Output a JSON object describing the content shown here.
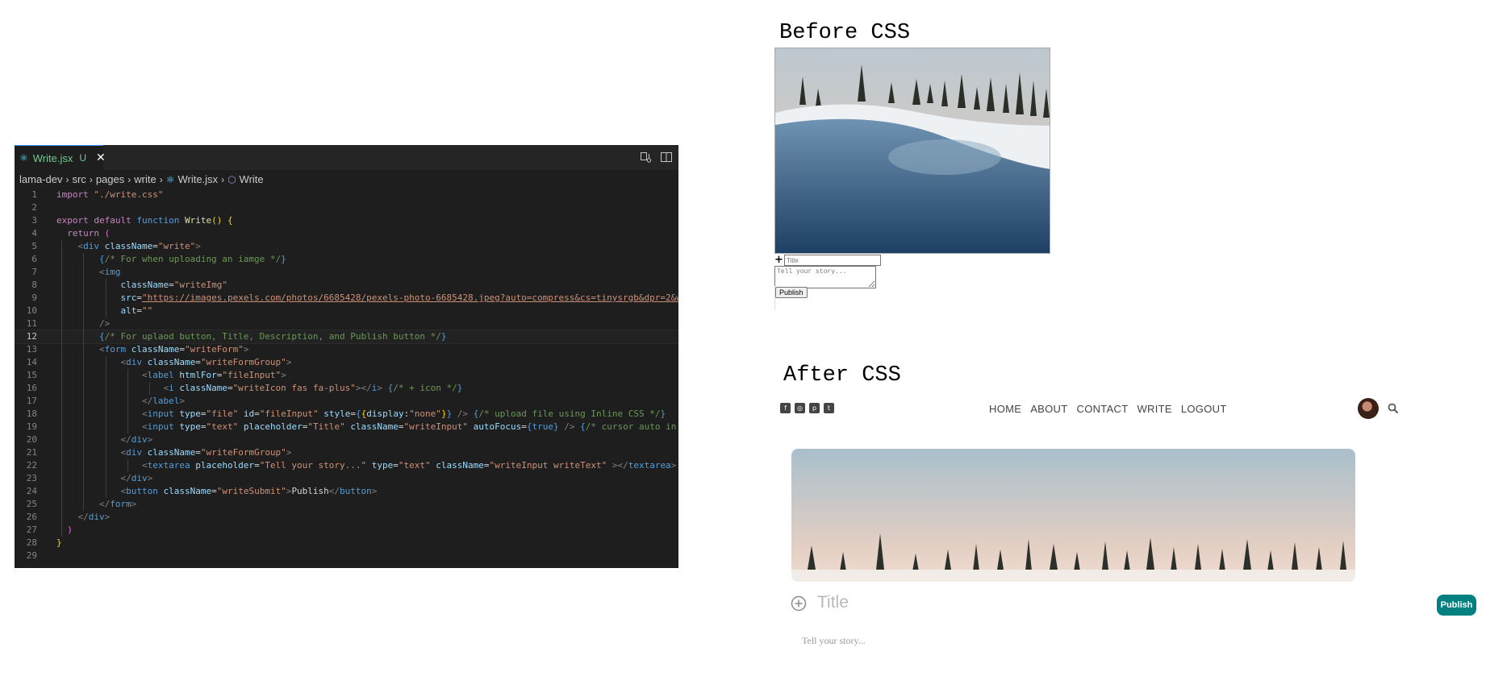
{
  "editor": {
    "tab": {
      "filename": "Write.jsx",
      "status": "U"
    },
    "breadcrumb": [
      "lama-dev",
      "src",
      "pages",
      "write",
      "Write.jsx",
      "Write"
    ],
    "current_line": 12,
    "line_numbers": [
      "1",
      "2",
      "3",
      "4",
      "5",
      "6",
      "7",
      "8",
      "9",
      "10",
      "11",
      "12",
      "13",
      "14",
      "15",
      "16",
      "17",
      "18",
      "19",
      "20",
      "21",
      "22",
      "23",
      "24",
      "25",
      "26",
      "27",
      "28",
      "29"
    ],
    "lines": [
      [
        [
          "kw",
          "import"
        ],
        [
          "txt",
          " "
        ],
        [
          "str",
          "\"./write.css\""
        ]
      ],
      [],
      [
        [
          "kw",
          "export"
        ],
        [
          "txt",
          " "
        ],
        [
          "kw",
          "default"
        ],
        [
          "txt",
          " "
        ],
        [
          "kw2",
          "function"
        ],
        [
          "txt",
          " "
        ],
        [
          "fn",
          "Write"
        ],
        [
          "brace",
          "()"
        ],
        [
          "txt",
          " "
        ],
        [
          "brace",
          "{"
        ]
      ],
      [
        [
          "txt",
          "  "
        ],
        [
          "kw",
          "return"
        ],
        [
          "txt",
          " "
        ],
        [
          "pink",
          "("
        ]
      ],
      [
        [
          "txt",
          "    "
        ],
        [
          "punc",
          "<"
        ],
        [
          "tag",
          "div"
        ],
        [
          "txt",
          " "
        ],
        [
          "attr",
          "className"
        ],
        [
          "txt",
          "="
        ],
        [
          "str",
          "\"write\""
        ],
        [
          "punc",
          ">"
        ]
      ],
      [
        [
          "txt",
          "        "
        ],
        [
          "tag",
          "{"
        ],
        [
          "cmt",
          "/* For when uploading an iamge */"
        ],
        [
          "tag",
          "}"
        ]
      ],
      [
        [
          "txt",
          "        "
        ],
        [
          "punc",
          "<"
        ],
        [
          "tag",
          "img"
        ]
      ],
      [
        [
          "txt",
          "            "
        ],
        [
          "attr",
          "className"
        ],
        [
          "txt",
          "="
        ],
        [
          "str",
          "\"writeImg\""
        ]
      ],
      [
        [
          "txt",
          "            "
        ],
        [
          "attr",
          "src"
        ],
        [
          "txt",
          "="
        ],
        [
          "link",
          "\"https://images.pexels.com/photos/6685428/pexels-photo-6685428.jpeg?auto=compress&cs=tinysrgb&dpr=2&w"
        ]
      ],
      [
        [
          "txt",
          "            "
        ],
        [
          "attr",
          "alt"
        ],
        [
          "txt",
          "="
        ],
        [
          "str",
          "\"\""
        ]
      ],
      [
        [
          "txt",
          "        "
        ],
        [
          "punc",
          "/>"
        ]
      ],
      [
        [
          "txt",
          "        "
        ],
        [
          "tag",
          "{"
        ],
        [
          "cmt",
          "/* For uplaod button, Title, Description, and Publish button */"
        ],
        [
          "tag",
          "}"
        ]
      ],
      [
        [
          "txt",
          "        "
        ],
        [
          "punc",
          "<"
        ],
        [
          "tag",
          "form"
        ],
        [
          "txt",
          " "
        ],
        [
          "attr",
          "className"
        ],
        [
          "txt",
          "="
        ],
        [
          "str",
          "\"writeForm\""
        ],
        [
          "punc",
          ">"
        ]
      ],
      [
        [
          "txt",
          "            "
        ],
        [
          "punc",
          "<"
        ],
        [
          "tag",
          "div"
        ],
        [
          "txt",
          " "
        ],
        [
          "attr",
          "className"
        ],
        [
          "txt",
          "="
        ],
        [
          "str",
          "\"writeFormGroup\""
        ],
        [
          "punc",
          ">"
        ]
      ],
      [
        [
          "txt",
          "                "
        ],
        [
          "punc",
          "<"
        ],
        [
          "tag",
          "label"
        ],
        [
          "txt",
          " "
        ],
        [
          "attr",
          "htmlFor"
        ],
        [
          "txt",
          "="
        ],
        [
          "str",
          "\"fileInput\""
        ],
        [
          "punc",
          ">"
        ]
      ],
      [
        [
          "txt",
          "                    "
        ],
        [
          "punc",
          "<"
        ],
        [
          "tag",
          "i"
        ],
        [
          "txt",
          " "
        ],
        [
          "attr",
          "className"
        ],
        [
          "txt",
          "="
        ],
        [
          "str",
          "\"writeIcon fas fa-plus\""
        ],
        [
          "punc",
          "></"
        ],
        [
          "tag",
          "i"
        ],
        [
          "punc",
          ">"
        ],
        [
          "txt",
          " "
        ],
        [
          "tag",
          "{"
        ],
        [
          "cmt",
          "/* + icon */"
        ],
        [
          "tag",
          "}"
        ]
      ],
      [
        [
          "txt",
          "                "
        ],
        [
          "punc",
          "</"
        ],
        [
          "tag",
          "label"
        ],
        [
          "punc",
          ">"
        ]
      ],
      [
        [
          "txt",
          "                "
        ],
        [
          "punc",
          "<"
        ],
        [
          "tag",
          "input"
        ],
        [
          "txt",
          " "
        ],
        [
          "attr",
          "type"
        ],
        [
          "txt",
          "="
        ],
        [
          "str",
          "\"file\""
        ],
        [
          "txt",
          " "
        ],
        [
          "attr",
          "id"
        ],
        [
          "txt",
          "="
        ],
        [
          "str",
          "\"fileInput\""
        ],
        [
          "txt",
          " "
        ],
        [
          "attr",
          "style"
        ],
        [
          "txt",
          "="
        ],
        [
          "tag",
          "{"
        ],
        [
          "brace",
          "{"
        ],
        [
          "attr",
          "display"
        ],
        [
          "txt",
          ":"
        ],
        [
          "str",
          "\"none\""
        ],
        [
          "brace",
          "}"
        ],
        [
          "tag",
          "}"
        ],
        [
          "txt",
          " "
        ],
        [
          "punc",
          "/>"
        ],
        [
          "txt",
          " "
        ],
        [
          "tag",
          "{"
        ],
        [
          "cmt",
          "/* upload file using Inline CSS */"
        ],
        [
          "tag",
          "}"
        ]
      ],
      [
        [
          "txt",
          "                "
        ],
        [
          "punc",
          "<"
        ],
        [
          "tag",
          "input"
        ],
        [
          "txt",
          " "
        ],
        [
          "attr",
          "type"
        ],
        [
          "txt",
          "="
        ],
        [
          "str",
          "\"text\""
        ],
        [
          "txt",
          " "
        ],
        [
          "attr",
          "placeholder"
        ],
        [
          "txt",
          "="
        ],
        [
          "str",
          "\"Title\""
        ],
        [
          "txt",
          " "
        ],
        [
          "attr",
          "className"
        ],
        [
          "txt",
          "="
        ],
        [
          "str",
          "\"writeInput\""
        ],
        [
          "txt",
          " "
        ],
        [
          "attr",
          "autoFocus"
        ],
        [
          "txt",
          "="
        ],
        [
          "tag",
          "{true}"
        ],
        [
          "txt",
          " "
        ],
        [
          "punc",
          "/>"
        ],
        [
          "txt",
          " "
        ],
        [
          "tag",
          "{"
        ],
        [
          "cmt",
          "/* cursor auto in"
        ]
      ],
      [
        [
          "txt",
          "            "
        ],
        [
          "punc",
          "</"
        ],
        [
          "tag",
          "div"
        ],
        [
          "punc",
          ">"
        ]
      ],
      [
        [
          "txt",
          "            "
        ],
        [
          "punc",
          "<"
        ],
        [
          "tag",
          "div"
        ],
        [
          "txt",
          " "
        ],
        [
          "attr",
          "className"
        ],
        [
          "txt",
          "="
        ],
        [
          "str",
          "\"writeFormGroup\""
        ],
        [
          "punc",
          ">"
        ]
      ],
      [
        [
          "txt",
          "                "
        ],
        [
          "punc",
          "<"
        ],
        [
          "tag",
          "textarea"
        ],
        [
          "txt",
          " "
        ],
        [
          "attr",
          "placeholder"
        ],
        [
          "txt",
          "="
        ],
        [
          "str",
          "\"Tell your story...\""
        ],
        [
          "txt",
          " "
        ],
        [
          "attr",
          "type"
        ],
        [
          "txt",
          "="
        ],
        [
          "str",
          "\"text\""
        ],
        [
          "txt",
          " "
        ],
        [
          "attr",
          "className"
        ],
        [
          "txt",
          "="
        ],
        [
          "str",
          "\"writeInput writeText\""
        ],
        [
          "txt",
          " "
        ],
        [
          "punc",
          "></"
        ],
        [
          "tag",
          "textarea"
        ],
        [
          "punc",
          ">"
        ]
      ],
      [
        [
          "txt",
          "            "
        ],
        [
          "punc",
          "</"
        ],
        [
          "tag",
          "div"
        ],
        [
          "punc",
          ">"
        ]
      ],
      [
        [
          "txt",
          "            "
        ],
        [
          "punc",
          "<"
        ],
        [
          "tag",
          "button"
        ],
        [
          "txt",
          " "
        ],
        [
          "attr",
          "className"
        ],
        [
          "txt",
          "="
        ],
        [
          "str",
          "\"writeSubmit\""
        ],
        [
          "punc",
          ">"
        ],
        [
          "txt",
          "Publish"
        ],
        [
          "punc",
          "</"
        ],
        [
          "tag",
          "button"
        ],
        [
          "punc",
          ">"
        ]
      ],
      [
        [
          "txt",
          "        "
        ],
        [
          "punc",
          "</"
        ],
        [
          "tag",
          "form"
        ],
        [
          "punc",
          ">"
        ]
      ],
      [
        [
          "txt",
          "    "
        ],
        [
          "punc",
          "</"
        ],
        [
          "tag",
          "div"
        ],
        [
          "punc",
          ">"
        ]
      ],
      [
        [
          "txt",
          "  "
        ],
        [
          "pink",
          ")"
        ]
      ],
      [
        [
          "brace",
          "}"
        ]
      ],
      []
    ]
  },
  "before": {
    "heading": "Before CSS",
    "plus_icon": "plus-icon",
    "title_placeholder": "Title",
    "story_placeholder": "Tell your story...",
    "publish_label": "Publish"
  },
  "after": {
    "heading": "After CSS",
    "social_icons": [
      "facebook-square-icon",
      "instagram-square-icon",
      "pinterest-square-icon",
      "twitter-square-icon"
    ],
    "menu": [
      "HOME",
      "ABOUT",
      "CONTACT",
      "WRITE",
      "LOGOUT"
    ],
    "title_placeholder": "Title",
    "story_placeholder": "Tell your story...",
    "publish_label": "Publish",
    "accent": "#008080"
  }
}
